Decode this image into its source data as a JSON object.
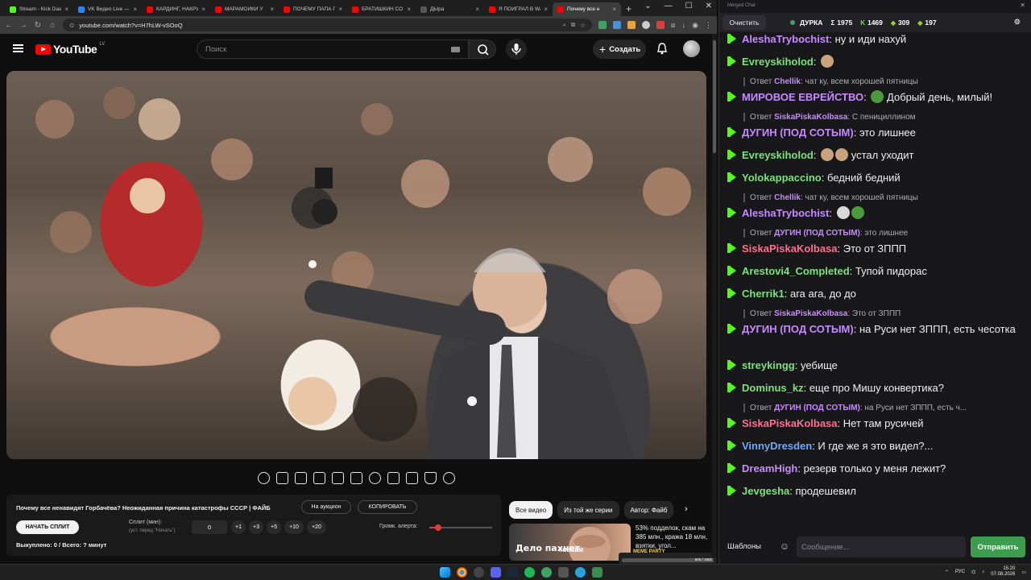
{
  "browser": {
    "tabs": [
      {
        "label": "Stream - Kick Dash",
        "color": "#53fc18",
        "active": false
      },
      {
        "label": "VK Видео Live —",
        "color": "#2787f5",
        "active": false
      },
      {
        "label": "КАРДИНГ, НАКРУ",
        "color": "#ff0000",
        "active": false
      },
      {
        "label": "МАРАМОЙКИ У",
        "color": "#ff0000",
        "active": false
      },
      {
        "label": "ПОЧЕМУ ПАПА П",
        "color": "#ff0000",
        "active": false
      },
      {
        "label": "БРАТИШКИН СО",
        "color": "#ff0000",
        "active": false
      },
      {
        "label": "ДЫра",
        "color": "#555555",
        "active": false
      },
      {
        "label": "Я ПОИГРАЛ В WA",
        "color": "#ff0000",
        "active": false
      },
      {
        "label": "Почему все н",
        "color": "#ff0000",
        "active": true
      }
    ],
    "new_tab": "+",
    "url": "youtube.com/watch?v=H7hLW-vSOoQ"
  },
  "youtube": {
    "logo": "YouTube",
    "region": "LV",
    "search_placeholder": "Поиск",
    "create_label": "Создать",
    "create_plus": "+"
  },
  "info": {
    "title": "Почему все ненавидят Горбачёва? Неожиданная причина катастрофы СССР | ФАЙБ",
    "auction_label": "На аукцион",
    "copy_label": "КОПИРОВАТЬ",
    "start_split_label": "НАЧАТЬ СПЛИТ",
    "split_label": "Сплит (мин):",
    "split_sub": "(уст. перед \"Начать\")",
    "split_value": "0",
    "steps": [
      "+1",
      "+3",
      "+5",
      "+10",
      "+20"
    ],
    "alert_volume_label": "Громк. алерта:",
    "alert_volume": 0.14,
    "bought": "Выкуплено: 0 / Всего: ? минут"
  },
  "chips": [
    {
      "label": "Все видео",
      "active": true
    },
    {
      "label": "Из той же серии",
      "active": false
    },
    {
      "label": "Автор: Файб",
      "active": false
    }
  ],
  "recommendation": {
    "thumb_text_1": "Дело пахнет",
    "thumb_text_2": "КОВСЕМ",
    "text": "53% подделок, скам на 385 млн., кража 18 млн, взятки, угол..."
  },
  "meme_party": {
    "title": "MEME PARTY",
    "value": "600 / 1500"
  },
  "chat": {
    "window_title": "Merged Chat",
    "clear_label": "Очистить",
    "channel": "ДУРКА",
    "stats": [
      {
        "icon": "Σ",
        "value": "1975"
      },
      {
        "icon": "K",
        "value": "1469"
      },
      {
        "icon": "◆",
        "value": "309"
      },
      {
        "icon": "◆",
        "value": "197"
      }
    ],
    "templates_label": "Шаблоны",
    "input_placeholder": "Сообщение...",
    "send_label": "Отправить",
    "messages": [
      {
        "type": "msg",
        "user": "AleshaTrybochist",
        "color": "#c78bff",
        "text": "ну и иди нахуй",
        "emotes": []
      },
      {
        "type": "msg",
        "user": "Evreyskiholod",
        "color": "#7ee07e",
        "text": "",
        "emotes": [
          "#c9a27e"
        ]
      },
      {
        "type": "reply",
        "reply_to": "Chellik",
        "reply_color": "#c78bff",
        "text": "чат ку, всем хорошей пятницы"
      },
      {
        "type": "msg",
        "user": "МИРОВОЕ ЕВРЕЙСТВО",
        "color": "#c78bff",
        "text": "Добрый день, милый!",
        "emotes": [
          "#4c9a3b"
        ]
      },
      {
        "type": "reply",
        "reply_to": "SiskaPiskaKolbasa",
        "reply_color": "#c78bff",
        "text": "С пенициллином"
      },
      {
        "type": "msg",
        "user": "ДУГИН (ПОД СОТЫМ)",
        "color": "#c78bff",
        "text": "это лишнее",
        "emotes": []
      },
      {
        "type": "msg",
        "user": "Evreyskiholod",
        "color": "#7ee07e",
        "text": "устал уходит",
        "emotes": [
          "#c9a27e",
          "#c9a27e"
        ]
      },
      {
        "type": "msg",
        "user": "Yolokappaccino",
        "color": "#7ee07e",
        "text": "бедний бедний",
        "emotes": []
      },
      {
        "type": "reply",
        "reply_to": "Chellik",
        "reply_color": "#c78bff",
        "text": "чат ку, всем хорошей пятницы"
      },
      {
        "type": "msg",
        "user": "AleshaTrybochist",
        "color": "#c78bff",
        "text": "",
        "emotes": [
          "#d8d8d8",
          "#4c9a3b"
        ]
      },
      {
        "type": "reply",
        "reply_to": "ДУГИН (ПОД СОТЫМ)",
        "reply_color": "#c78bff",
        "text": "это лишнее"
      },
      {
        "type": "msg",
        "user": "SiskaPiskaKolbasa",
        "color": "#ff6f8f",
        "text": "Это от ЗППП",
        "emotes": []
      },
      {
        "type": "msg",
        "user": "Arestovi4_Completed",
        "color": "#7ee07e",
        "text": "Тупой пидорас",
        "emotes": []
      },
      {
        "type": "msg",
        "user": "Cherrik1",
        "color": "#7ee07e",
        "text": "ага ага, до до",
        "emotes": []
      },
      {
        "type": "reply",
        "reply_to": "SiskaPiskaKolbasa",
        "reply_color": "#c78bff",
        "text": "Это от ЗППП"
      },
      {
        "type": "msg",
        "user": "ДУГИН (ПОД СОТЫМ)",
        "color": "#c78bff",
        "text": "на Руси нет ЗППП, есть чесотка",
        "emotes": []
      },
      {
        "type": "msg",
        "user": "streykingg",
        "color": "#7ee07e",
        "text": "уебище",
        "emotes": []
      },
      {
        "type": "msg",
        "user": "Dominus_kz",
        "color": "#7ee07e",
        "text": "еще про Мишу конвертика?",
        "emotes": []
      },
      {
        "type": "reply",
        "reply_to": "ДУГИН (ПОД СОТЫМ)",
        "reply_color": "#c78bff",
        "text": "на Руси нет ЗППП, есть ч..."
      },
      {
        "type": "msg",
        "user": "SiskaPiskaKolbasa",
        "color": "#ff6f8f",
        "text": "Нет там русичей",
        "emotes": []
      },
      {
        "type": "msg",
        "user": "VinnyDresden",
        "color": "#6ea8ff",
        "text": "И где же я это видел?...",
        "emotes": []
      },
      {
        "type": "msg",
        "user": "DreamHigh",
        "color": "#c78bff",
        "text": "резерв только у меня лежит?",
        "emotes": []
      },
      {
        "type": "msg",
        "user": "Jevgesha",
        "color": "#7ee07e",
        "text": "продешевил",
        "emotes": []
      }
    ]
  },
  "taskbar": {
    "lang": "РУС",
    "time": "15:20",
    "date": "07.08.2026"
  }
}
